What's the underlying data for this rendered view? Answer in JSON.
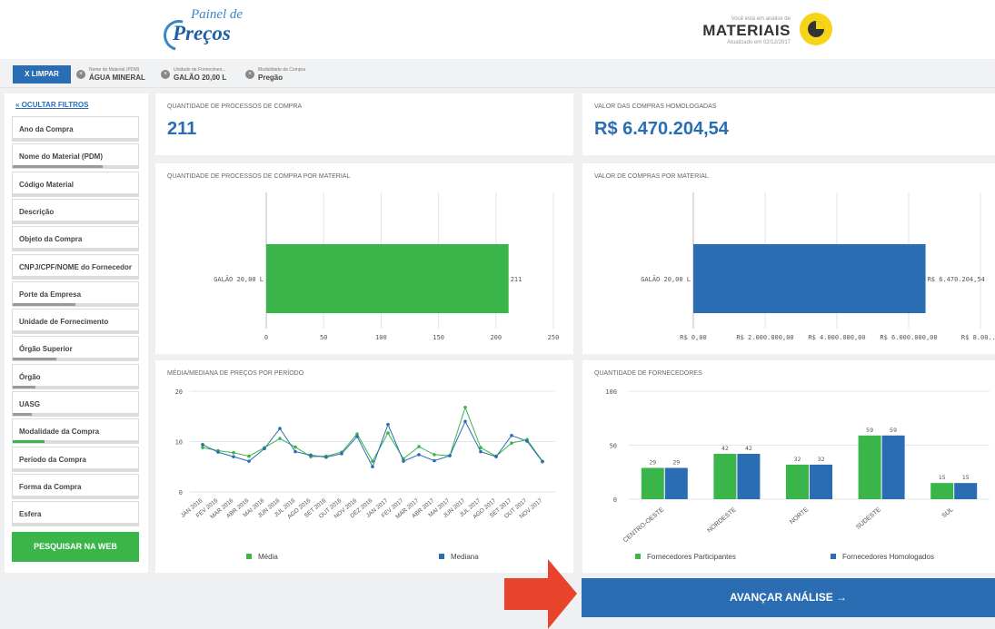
{
  "header": {
    "logo_line1": "Painel de",
    "logo_line2": "Preços",
    "context_caption": "Você está em análise de",
    "context_title": "MATERIAIS",
    "updated": "Atualizado em 02/12/2017",
    "badge_icon": "pie-chart-icon"
  },
  "filterbar": {
    "clear_label": "X  LIMPAR",
    "chips": [
      {
        "key": "Nome do Material (PDM)",
        "value": "ÁGUA MINERAL"
      },
      {
        "key": "Unidade de Fornecimen...",
        "value": "GALÃO 20,00 L"
      },
      {
        "key": "Modalidade da Compra",
        "value": "Pregão"
      }
    ]
  },
  "sidebar": {
    "hide_label": "OCULTAR FILTROS",
    "items": [
      {
        "label": "Ano da Compra",
        "fill": 0
      },
      {
        "label": "Nome do Material (PDM)",
        "fill": 0.72
      },
      {
        "label": "Código Material",
        "fill": 0
      },
      {
        "label": "Descrição",
        "fill": 0
      },
      {
        "label": "Objeto da Compra",
        "fill": 0
      },
      {
        "label": "CNPJ/CPF/NOME do Fornecedor",
        "fill": 0
      },
      {
        "label": "Porte da Empresa",
        "fill": 0.5
      },
      {
        "label": "Unidade de Fornecimento",
        "fill": 0
      },
      {
        "label": "Órgão Superior",
        "fill": 0.35
      },
      {
        "label": "Órgão",
        "fill": 0.18
      },
      {
        "label": "UASG",
        "fill": 0.15
      },
      {
        "label": "Modalidade da Compra",
        "fill": 0.25,
        "accent": true
      },
      {
        "label": "Período da Compra",
        "fill": 0
      },
      {
        "label": "Forma da Compra",
        "fill": 0
      },
      {
        "label": "Esfera",
        "fill": 0
      }
    ],
    "search_web_label": "PESQUISAR NA WEB"
  },
  "cards": {
    "qty_title": "QUANTIDADE DE PROCESSOS DE COMPRA",
    "qty_value": "211",
    "val_title": "VALOR DAS COMPRAS HOMOLOGADAS",
    "val_value": "R$ 6.470.204,54"
  },
  "colors": {
    "green": "#3ab54a",
    "blue": "#2a6db2"
  },
  "chart_data": [
    {
      "type": "bar",
      "title": "QUANTIDADE DE PROCESSOS DE COMPRA POR MATERIAL",
      "orientation": "horizontal",
      "categories": [
        "GALÃO 20,00 L"
      ],
      "values": [
        211
      ],
      "value_labels": [
        "211"
      ],
      "xticks": [
        "0",
        "50",
        "100",
        "150",
        "200",
        "250"
      ],
      "xlim": [
        0,
        250
      ]
    },
    {
      "type": "bar",
      "title": "VALOR DE COMPRAS POR MATERIAL",
      "orientation": "horizontal",
      "categories": [
        "GALÃO 20,00 L"
      ],
      "values": [
        6470204.54
      ],
      "value_labels": [
        "R$ 6.470.204,54"
      ],
      "xticks": [
        "R$ 0,00",
        "R$ 2.000.000,00",
        "R$ 4.000.000,00",
        "R$ 6.000.000,00",
        "R$ 8.00..."
      ],
      "xlim": [
        0,
        8000000
      ]
    },
    {
      "type": "line",
      "title": "MÉDIA/MEDIANA DE PREÇOS POR PERÍODO",
      "categories": [
        "JAN 2016",
        "FEV 2016",
        "MAR 2016",
        "ABR 2016",
        "MAI 2016",
        "JUN 2016",
        "JUL 2016",
        "AGO 2016",
        "SET 2016",
        "OUT 2016",
        "NOV 2016",
        "DEZ 2016",
        "JAN 2017",
        "FEV 2017",
        "MAR 2017",
        "ABR 2017",
        "MAI 2017",
        "JUN 2017",
        "JUL 2017",
        "AGO 2017",
        "SET 2017",
        "OUT 2017",
        "NOV 2017"
      ],
      "series": [
        {
          "name": "Média",
          "values": [
            8.8,
            8.2,
            7.8,
            7.1,
            8.8,
            10.6,
            8.9,
            7.0,
            7.1,
            7.9,
            11.5,
            6.1,
            11.7,
            6.6,
            9.0,
            7.4,
            7.2,
            16.8,
            8.8,
            7.1,
            9.7,
            10.4,
            6.1
          ]
        },
        {
          "name": "Mediana",
          "values": [
            9.4,
            7.9,
            7.0,
            6.1,
            8.6,
            12.6,
            8.0,
            7.3,
            6.9,
            7.6,
            11.0,
            5.0,
            13.4,
            6.1,
            7.4,
            6.2,
            7.2,
            14.0,
            8.0,
            7.0,
            11.2,
            10.1,
            6.0
          ]
        }
      ],
      "yticks": [
        "0",
        "10",
        "20"
      ],
      "ylim": [
        0,
        20
      ],
      "legend": "bottom"
    },
    {
      "type": "bar",
      "title": "QUANTIDADE DE FORNECEDORES",
      "categories": [
        "CENTRO-OESTE",
        "NORDESTE",
        "NORTE",
        "SUDESTE",
        "SUL"
      ],
      "series": [
        {
          "name": "Fornecedores Participantes",
          "values": [
            29,
            42,
            32,
            59,
            15
          ]
        },
        {
          "name": "Fornecedores Homologados",
          "values": [
            29,
            42,
            32,
            59,
            15
          ]
        }
      ],
      "yticks": [
        "0",
        "50",
        "100"
      ],
      "ylim": [
        0,
        100
      ],
      "legend": "bottom"
    }
  ],
  "advance_label": "AVANÇAR ANÁLISE  →"
}
